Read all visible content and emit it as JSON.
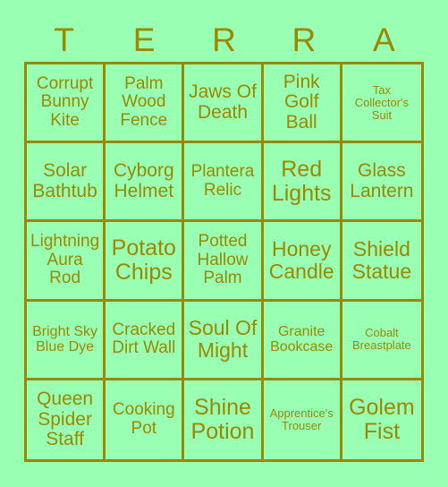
{
  "card": {
    "title_letters": [
      "T",
      "E",
      "R",
      "R",
      "A"
    ],
    "colors": {
      "background": "#99FFB3",
      "cell_fill": "#99FFB3",
      "ink": "#998800",
      "border": "#998800"
    },
    "grid": {
      "columns": 5,
      "rows": 5
    },
    "cells": [
      {
        "text": "Corrupt Bunny Kite",
        "size": "md"
      },
      {
        "text": "Palm Wood Fence",
        "size": "md"
      },
      {
        "text": "Jaws Of Death",
        "size": "lg"
      },
      {
        "text": "Pink Golf Ball",
        "size": "lg"
      },
      {
        "text": "Tax Collector's Suit",
        "size": "xs"
      },
      {
        "text": "Solar Bathtub",
        "size": "lg"
      },
      {
        "text": "Cyborg Helmet",
        "size": "lg"
      },
      {
        "text": "Plantera Relic",
        "size": "md"
      },
      {
        "text": "Red Lights",
        "size": "xxl"
      },
      {
        "text": "Glass Lantern",
        "size": "lg"
      },
      {
        "text": "Lightning Aura Rod",
        "size": "md"
      },
      {
        "text": "Potato Chips",
        "size": "xxl"
      },
      {
        "text": "Potted Hallow Palm",
        "size": "md"
      },
      {
        "text": "Honey Candle",
        "size": "xl"
      },
      {
        "text": "Shield Statue",
        "size": "xl"
      },
      {
        "text": "Bright Sky Blue Dye",
        "size": "sm"
      },
      {
        "text": "Cracked Dirt Wall",
        "size": "md"
      },
      {
        "text": "Soul Of Might",
        "size": "xl"
      },
      {
        "text": "Granite Bookcase",
        "size": "sm"
      },
      {
        "text": "Cobalt Breastplate",
        "size": "xs"
      },
      {
        "text": "Queen Spider Staff",
        "size": "lg"
      },
      {
        "text": "Cooking Pot",
        "size": "md"
      },
      {
        "text": "Shine Potion",
        "size": "xxl"
      },
      {
        "text": "Apprentice's Trouser",
        "size": "xs"
      },
      {
        "text": "Golem Fist",
        "size": "xxl"
      }
    ]
  }
}
